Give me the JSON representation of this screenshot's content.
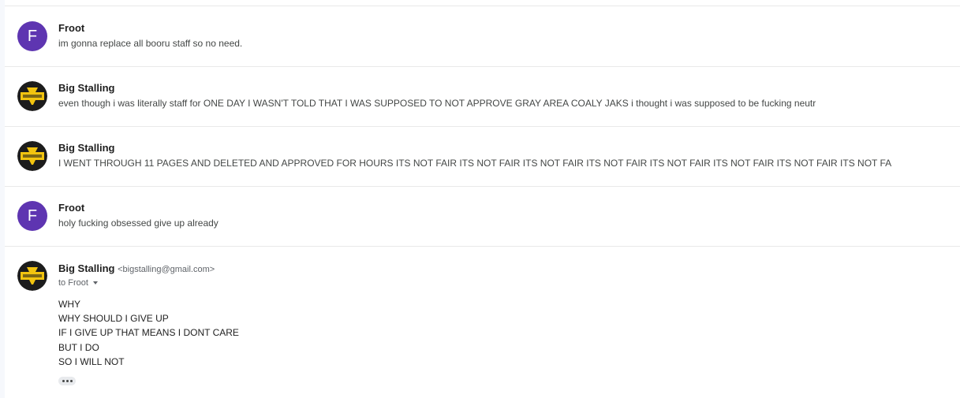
{
  "colors": {
    "froot_avatar": "#5e35b1",
    "stalling_avatar_bg": "#1c1c1c",
    "stalling_avatar_band": "#f2c40f"
  },
  "messages": [
    {
      "sender": "Froot",
      "avatar_letter": "F",
      "snippet": "im gonna replace all booru staff so no need."
    },
    {
      "sender": "Big Stalling",
      "avatar_icon": "wu-tang-logo-icon",
      "snippet": "even though i was literally staff for ONE DAY I WASN'T TOLD THAT I WAS SUPPOSED TO NOT APPROVE GRAY AREA COALY JAKS i thought i was supposed to be fucking neutr"
    },
    {
      "sender": "Big Stalling",
      "avatar_icon": "wu-tang-logo-icon",
      "snippet": "I WENT THROUGH 11 PAGES AND DELETED AND APPROVED FOR HOURS ITS NOT FAIR ITS NOT FAIR ITS NOT FAIR ITS NOT FAIR ITS NOT FAIR ITS NOT FAIR ITS NOT FAIR ITS NOT FA"
    },
    {
      "sender": "Froot",
      "avatar_letter": "F",
      "snippet": "holy fucking obsessed give up already"
    }
  ],
  "expanded": {
    "sender": "Big Stalling",
    "email": "<bigstalling@gmail.com>",
    "to": "to Froot",
    "avatar_icon": "wu-tang-logo-icon",
    "body_lines": [
      "WHY",
      "WHY SHOULD I GIVE UP",
      "IF I GIVE UP THAT MEANS I DONT CARE",
      "BUT I DO",
      "SO I WILL NOT"
    ],
    "show_trimmed_icon": "more-horizontal-icon"
  }
}
